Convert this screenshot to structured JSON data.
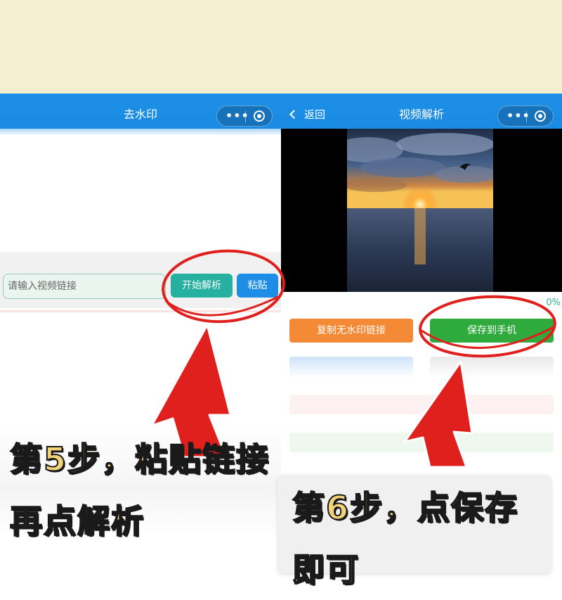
{
  "left_screen": {
    "nav": {
      "title": "去水印"
    },
    "input": {
      "placeholder": "请输入视频链接"
    },
    "buttons": {
      "parse_label": "开始解析",
      "paste_label": "粘贴"
    },
    "caption": {
      "line1": "第5步，粘贴链接",
      "line2": "再点解析"
    }
  },
  "right_screen": {
    "nav": {
      "back_label": "返回",
      "title": "视频解析"
    },
    "progress": {
      "percent_label": "0%",
      "value": 0
    },
    "buttons": {
      "copy_label": "复制无水印链接",
      "save_label": "保存到手机"
    },
    "caption": {
      "line1": "第6步，点保存",
      "line2": "即可"
    }
  },
  "colors": {
    "nav_blue": "#1e8fe6",
    "parse_teal": "#26b0a0",
    "paste_blue": "#1d8de5",
    "copy_orange": "#f58a36",
    "save_green": "#2eab3c",
    "annotation_red": "#e0201c",
    "caption_yellow": "#f3d37a"
  },
  "icons": [
    "more-dots-icon",
    "target-circle-icon",
    "back-chevron-icon",
    "red-arrow-icon",
    "red-circle-highlight-icon"
  ]
}
